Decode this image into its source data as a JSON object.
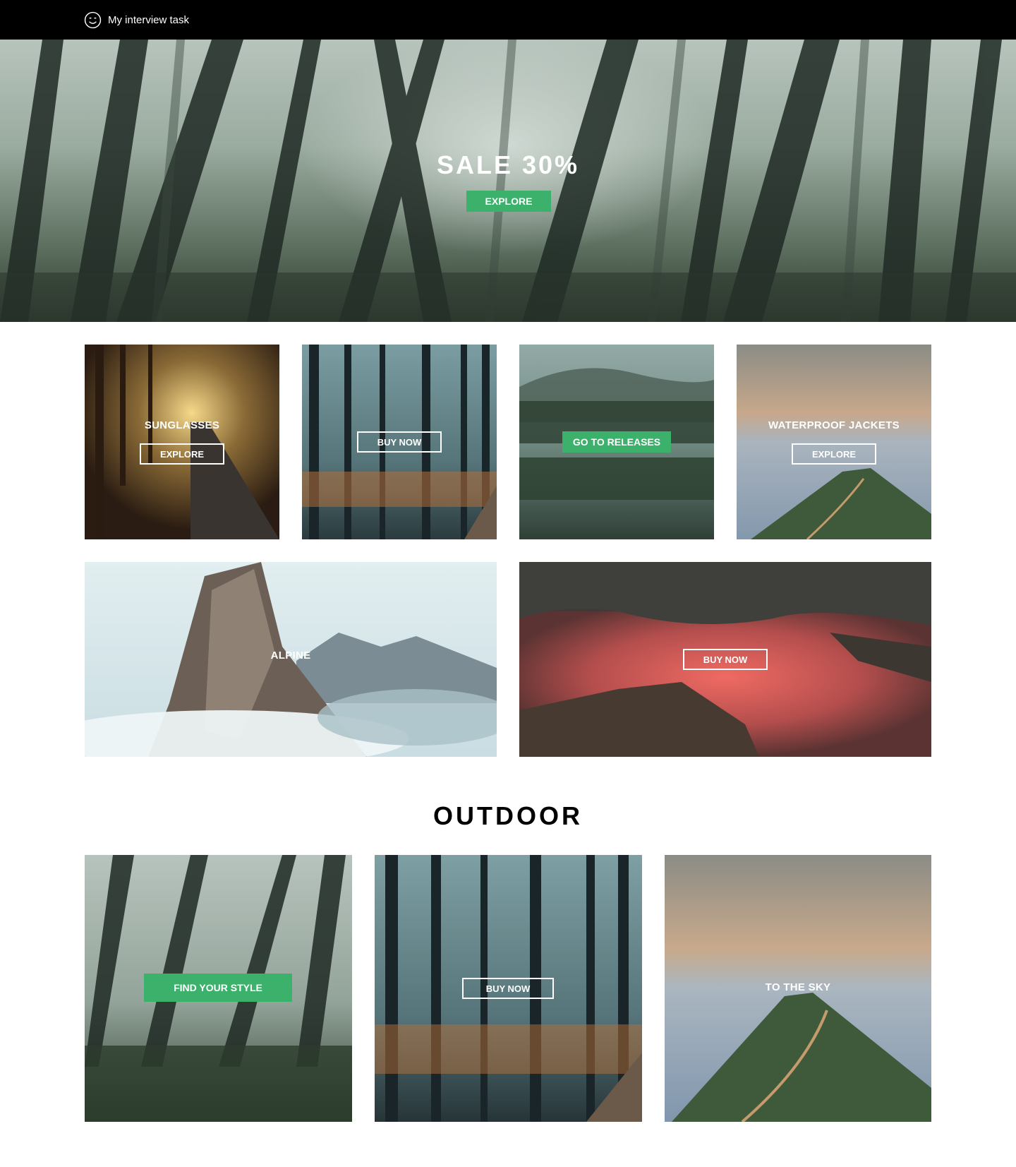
{
  "nav": {
    "brand_icon": "smiley-icon",
    "brand_title": "My interview task"
  },
  "hero": {
    "title": "SALE 30%",
    "button_label": "EXPLORE",
    "accent_color": "#3bb16b"
  },
  "promo_tiles": [
    {
      "title": "SUNGLASSES",
      "button_label": "EXPLORE",
      "button_style": "outline"
    },
    {
      "button_label": "BUY NOW",
      "button_style": "outline"
    },
    {
      "button_label": "GO TO RELEASES",
      "button_style": "filled"
    },
    {
      "title": "WATERPROOF JACKETS",
      "button_label": "EXPLORE",
      "button_style": "outline"
    },
    {
      "title": "ALPINE"
    },
    {
      "button_label": "BUY NOW",
      "button_style": "outline"
    }
  ],
  "outdoor": {
    "section_title": "OUTDOOR",
    "tiles": [
      {
        "button_label": "FIND YOUR STYLE",
        "button_style": "filled"
      },
      {
        "button_label": "BUY NOW",
        "button_style": "outline"
      },
      {
        "title": "TO THE SKY"
      }
    ]
  }
}
